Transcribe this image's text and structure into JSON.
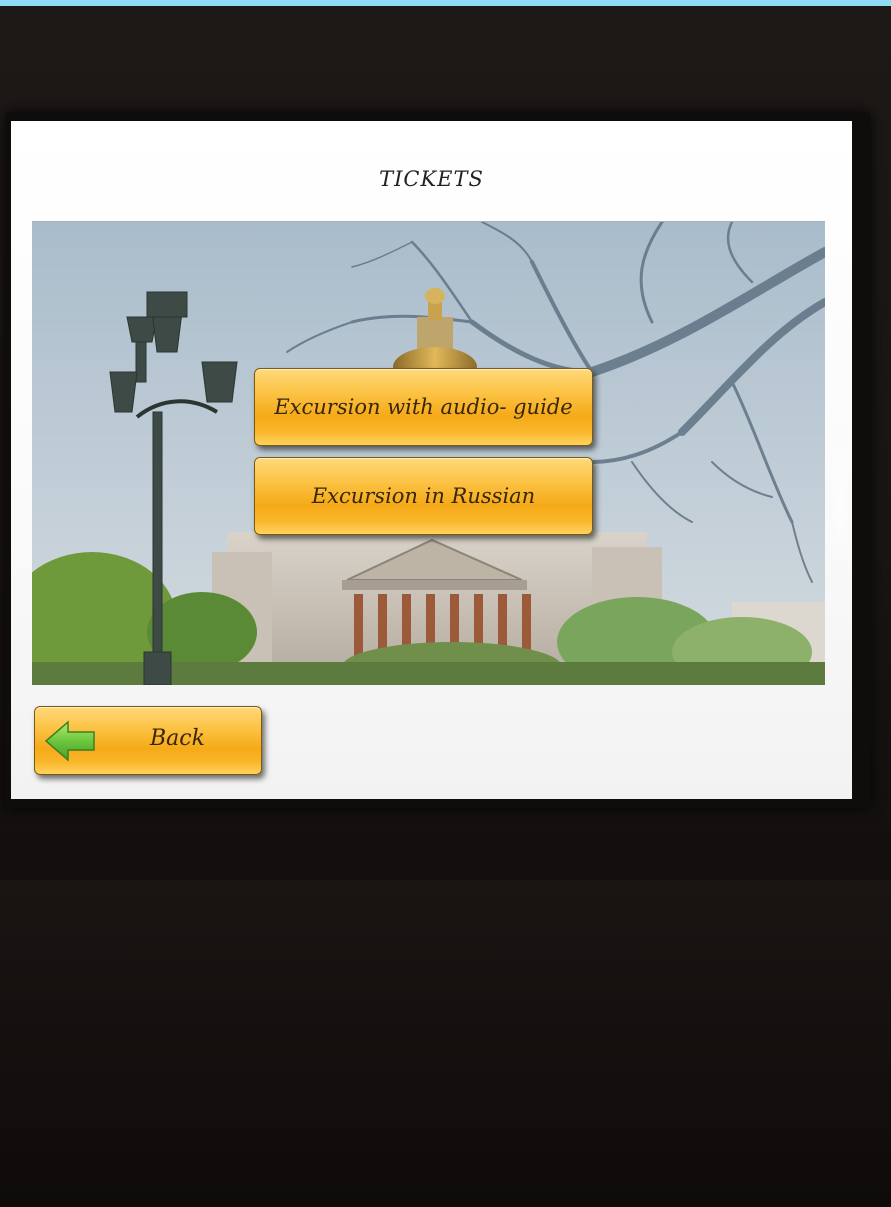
{
  "screen": {
    "title": "TICKETS"
  },
  "menu": {
    "buttons": [
      {
        "label": "Excursion with audio- guide"
      },
      {
        "label": "Excursion in Russian"
      }
    ]
  },
  "footer": {
    "back_label": "Back",
    "back_icon": "left-arrow-icon"
  },
  "colors": {
    "button_gold": "#f5aa18",
    "arrow_green": "#6cc63e",
    "screen_background": "#ffffff",
    "accent_strip": "#8fdcf5"
  }
}
